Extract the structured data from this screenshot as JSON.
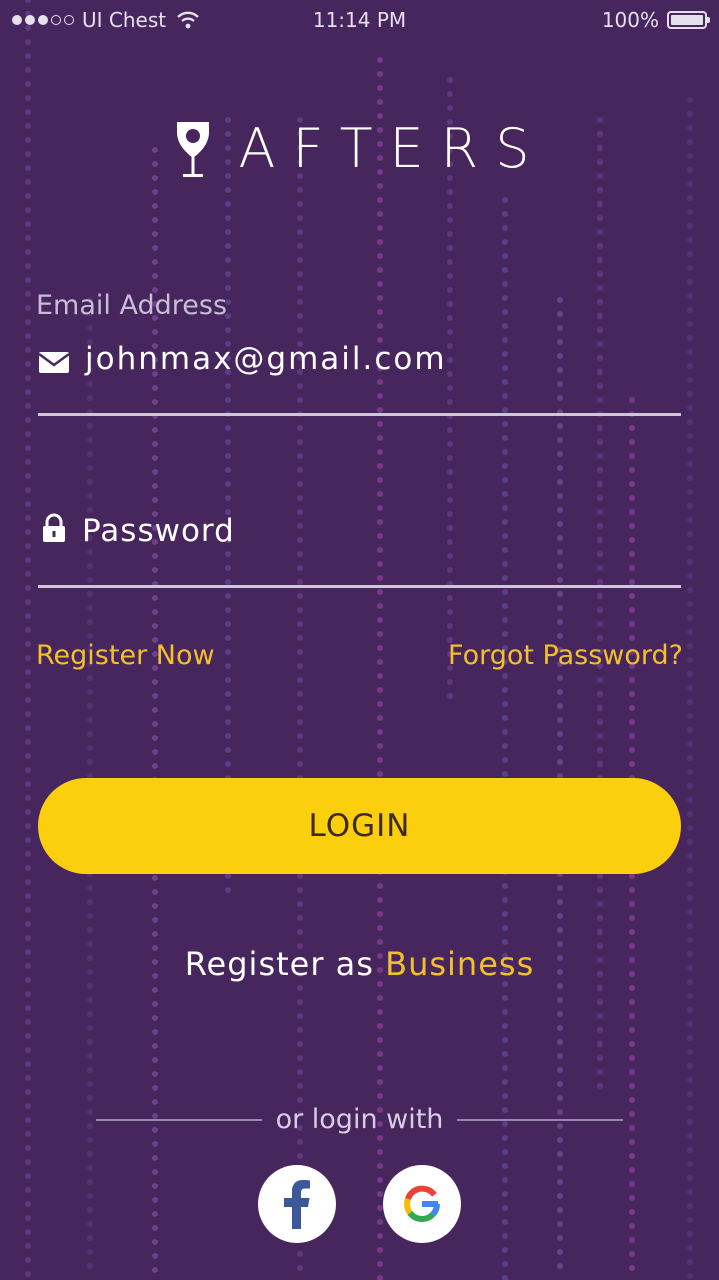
{
  "status_bar": {
    "carrier": "UI Chest",
    "time": "11:14 PM",
    "battery": "100%",
    "signal_bars": 3,
    "battery_level": 1.0
  },
  "logo": {
    "text": "AFTERS",
    "icon": "wine-glass-pin-icon"
  },
  "form": {
    "email_label": "Email Address",
    "email_value": "johnmax@gmail.com",
    "email_icon": "envelope-icon",
    "password_placeholder": "Password",
    "password_icon": "lock-icon"
  },
  "links": {
    "register_now": "Register Now",
    "forgot_password": "Forgot Password?"
  },
  "login_button": "LOGIN",
  "register_business": {
    "prefix": "Register as",
    "accent": "Business"
  },
  "social": {
    "divider_text": "or login with",
    "providers": [
      "facebook-icon",
      "google-icon"
    ]
  },
  "colors": {
    "background": "#47265e",
    "accent": "#f4c02a",
    "button": "#fccf0e",
    "button_text": "#3d2a25"
  }
}
